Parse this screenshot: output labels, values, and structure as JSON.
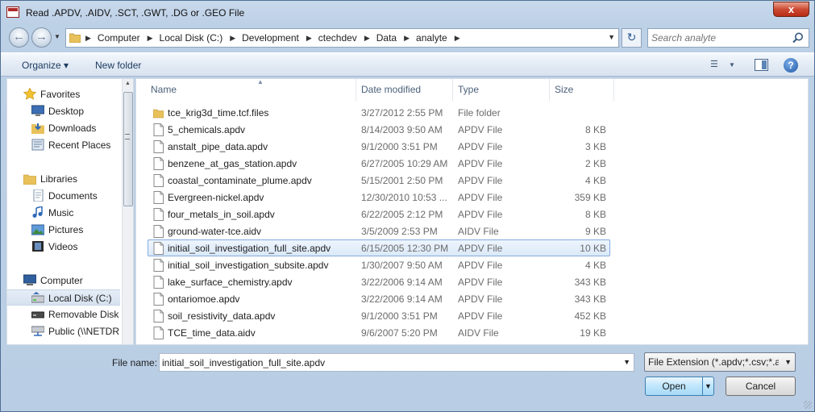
{
  "window": {
    "title": "Read .APDV, .AIDV, .SCT, .GWT, .DG or .GEO File",
    "close_glyph": "x"
  },
  "address_bar": {
    "crumbs": [
      "Computer",
      "Local Disk (C:)",
      "Development",
      "ctechdev",
      "Data",
      "analyte"
    ]
  },
  "search": {
    "placeholder": "Search analyte"
  },
  "toolbar": {
    "organize_label": "Organize ▾",
    "new_folder_label": "New folder"
  },
  "nav_pane": {
    "items": [
      {
        "label": "Favorites",
        "icon": "star-icon"
      },
      {
        "label": "Desktop",
        "icon": "desktop-icon"
      },
      {
        "label": "Downloads",
        "icon": "downloads-icon"
      },
      {
        "label": "Recent Places",
        "icon": "recent-places-icon"
      },
      {
        "label": "Libraries",
        "icon": "libraries-icon"
      },
      {
        "label": "Documents",
        "icon": "documents-icon"
      },
      {
        "label": "Music",
        "icon": "music-icon"
      },
      {
        "label": "Pictures",
        "icon": "pictures-icon"
      },
      {
        "label": "Videos",
        "icon": "videos-icon"
      },
      {
        "label": "Computer",
        "icon": "computer-icon"
      },
      {
        "label": "Local Disk (C:)",
        "icon": "drive-icon"
      },
      {
        "label": "Removable Disk (",
        "icon": "removable-drive-icon"
      },
      {
        "label": "Public (\\\\NETDRI",
        "icon": "network-drive-icon"
      }
    ]
  },
  "file_list": {
    "columns": {
      "name": "Name",
      "date": "Date modified",
      "type": "Type",
      "size": "Size"
    },
    "rows": [
      {
        "name": "tce_krig3d_time.tcf.files",
        "date": "3/27/2012 2:55 PM",
        "type": "File folder",
        "size": "",
        "kind": "folder"
      },
      {
        "name": "5_chemicals.apdv",
        "date": "8/14/2003 9:50 AM",
        "type": "APDV File",
        "size": "8 KB",
        "kind": "file"
      },
      {
        "name": "anstalt_pipe_data.apdv",
        "date": "9/1/2000 3:51 PM",
        "type": "APDV File",
        "size": "3 KB",
        "kind": "file"
      },
      {
        "name": "benzene_at_gas_station.apdv",
        "date": "6/27/2005 10:29 AM",
        "type": "APDV File",
        "size": "2 KB",
        "kind": "file"
      },
      {
        "name": "coastal_contaminate_plume.apdv",
        "date": "5/15/2001 2:50 PM",
        "type": "APDV File",
        "size": "4 KB",
        "kind": "file"
      },
      {
        "name": "Evergreen-nickel.apdv",
        "date": "12/30/2010 10:53 ...",
        "type": "APDV File",
        "size": "359 KB",
        "kind": "file"
      },
      {
        "name": "four_metals_in_soil.apdv",
        "date": "6/22/2005 2:12 PM",
        "type": "APDV File",
        "size": "8 KB",
        "kind": "file"
      },
      {
        "name": "ground-water-tce.aidv",
        "date": "3/5/2009 2:53 PM",
        "type": "AIDV File",
        "size": "9 KB",
        "kind": "file"
      },
      {
        "name": "initial_soil_investigation_full_site.apdv",
        "date": "6/15/2005 12:30 PM",
        "type": "APDV File",
        "size": "10 KB",
        "kind": "file",
        "selected": true
      },
      {
        "name": "initial_soil_investigation_subsite.apdv",
        "date": "1/30/2007 9:50 AM",
        "type": "APDV File",
        "size": "4 KB",
        "kind": "file"
      },
      {
        "name": "lake_surface_chemistry.apdv",
        "date": "3/22/2006 9:14 AM",
        "type": "APDV File",
        "size": "343 KB",
        "kind": "file"
      },
      {
        "name": "ontariomoe.apdv",
        "date": "3/22/2006 9:14 AM",
        "type": "APDV File",
        "size": "343 KB",
        "kind": "file"
      },
      {
        "name": "soil_resistivity_data.apdv",
        "date": "9/1/2000 3:51 PM",
        "type": "APDV File",
        "size": "452 KB",
        "kind": "file"
      },
      {
        "name": "TCE_time_data.aidv",
        "date": "9/6/2007 5:20 PM",
        "type": "AIDV File",
        "size": "19 KB",
        "kind": "file"
      }
    ]
  },
  "footer": {
    "file_name_label": "File name:",
    "file_name_value": "initial_soil_investigation_full_site.apdv",
    "filter_value": "File Extension (*.apdv;*.csv;*.ai",
    "open_label": "Open",
    "cancel_label": "Cancel"
  },
  "colors": {
    "accent": "#3c7fb1",
    "selection": "#dbe9f8",
    "chrome": "#bcd0e6"
  }
}
